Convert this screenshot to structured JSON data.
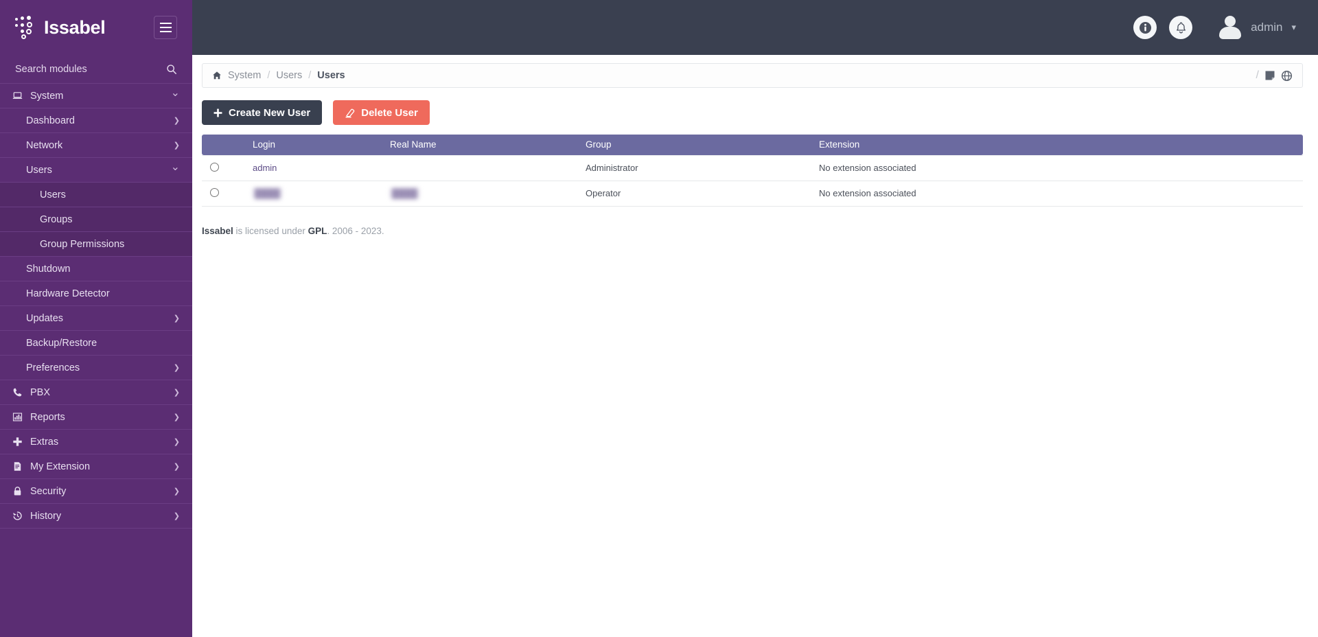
{
  "brand": {
    "name": "Issabel",
    "logo_icon": "issabel-dots-logo",
    "menu_toggle_icon": "hamburger-icon"
  },
  "header": {
    "info_icon": "info-circle-icon",
    "notifications_icon": "bell-icon",
    "avatar_icon": "user-avatar-icon",
    "user_name": "admin",
    "caret_icon": "chevron-down-icon"
  },
  "sidebar": {
    "search_placeholder": "Search modules",
    "search_value": "",
    "search_icon": "search-icon",
    "items": [
      {
        "label": "System",
        "icon": "laptop-icon",
        "level": "top",
        "chevron": "down"
      },
      {
        "label": "Dashboard",
        "icon": "",
        "level": "sub",
        "chevron": "right"
      },
      {
        "label": "Network",
        "icon": "",
        "level": "sub",
        "chevron": "right"
      },
      {
        "label": "Users",
        "icon": "",
        "level": "sub",
        "chevron": "down"
      },
      {
        "label": "Users",
        "icon": "",
        "level": "subsub",
        "chevron": ""
      },
      {
        "label": "Groups",
        "icon": "",
        "level": "subsub",
        "chevron": ""
      },
      {
        "label": "Group Permissions",
        "icon": "",
        "level": "subsub",
        "chevron": ""
      },
      {
        "label": "Shutdown",
        "icon": "",
        "level": "sub",
        "chevron": ""
      },
      {
        "label": "Hardware Detector",
        "icon": "",
        "level": "sub",
        "chevron": ""
      },
      {
        "label": "Updates",
        "icon": "",
        "level": "sub",
        "chevron": "right"
      },
      {
        "label": "Backup/Restore",
        "icon": "",
        "level": "sub",
        "chevron": ""
      },
      {
        "label": "Preferences",
        "icon": "",
        "level": "sub",
        "chevron": "right"
      },
      {
        "label": "PBX",
        "icon": "phone-icon",
        "level": "top",
        "chevron": "right"
      },
      {
        "label": "Reports",
        "icon": "bar-chart-icon",
        "level": "top",
        "chevron": "right"
      },
      {
        "label": "Extras",
        "icon": "plus-icon",
        "level": "top",
        "chevron": "right"
      },
      {
        "label": "My Extension",
        "icon": "fax-icon",
        "level": "top",
        "chevron": "right"
      },
      {
        "label": "Security",
        "icon": "lock-icon",
        "level": "top",
        "chevron": "right"
      },
      {
        "label": "History",
        "icon": "history-icon",
        "level": "top",
        "chevron": "right"
      }
    ]
  },
  "breadcrumb": {
    "home_icon": "home-icon",
    "crumbs": [
      "System",
      "Users",
      "Users"
    ],
    "separator": "/",
    "trailing_separator": "/",
    "note_icon": "note-icon",
    "globe_icon": "globe-icon"
  },
  "toolbar": {
    "create_label": "Create New User",
    "create_icon": "plus-icon",
    "delete_label": "Delete User",
    "delete_icon": "eraser-icon"
  },
  "table": {
    "columns": [
      "",
      "Login",
      "Real Name",
      "Group",
      "Extension"
    ],
    "rows": [
      {
        "selected": false,
        "login": "admin",
        "login_redacted": false,
        "real_name": "",
        "real_name_redacted": false,
        "group": "Administrator",
        "extension": "No extension associated"
      },
      {
        "selected": false,
        "login": "████",
        "login_redacted": true,
        "real_name": "████",
        "real_name_redacted": true,
        "group": "Operator",
        "extension": "No extension associated"
      }
    ]
  },
  "footer": {
    "brand": "Issabel",
    "text_mid": " is licensed under ",
    "license": "GPL",
    "years": ". 2006 - 2023."
  },
  "colors": {
    "brand_purple": "#5b2d73",
    "topbar_dark": "#3a4050",
    "table_header": "#6b6aa0",
    "danger": "#ef6a5c",
    "dark_button": "#39404f"
  }
}
